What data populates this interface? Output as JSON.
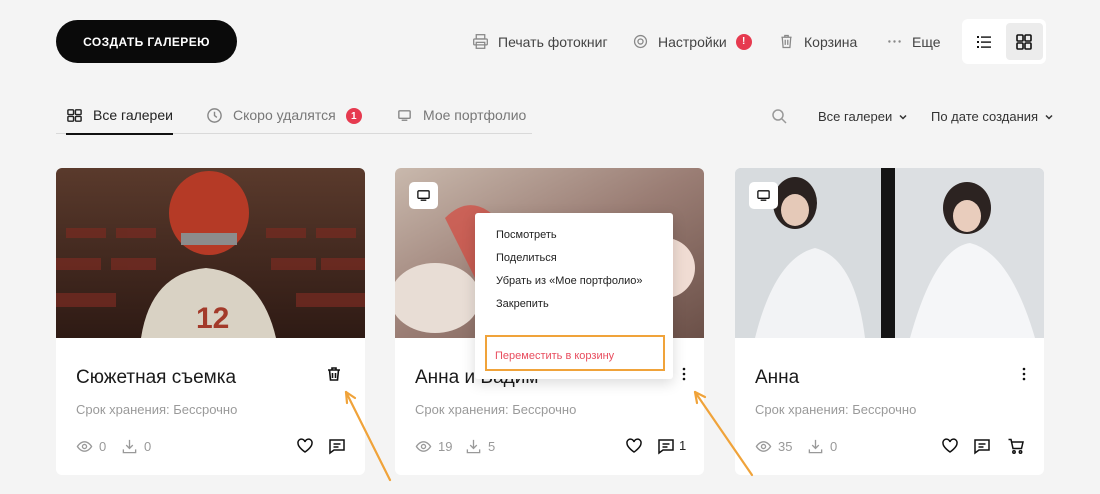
{
  "header": {
    "create_button": "СОЗДАТЬ ГАЛЕРЕЮ",
    "print_label": "Печать фотокниг",
    "settings_label": "Настройки",
    "settings_badge": "!",
    "trash_label": "Корзина",
    "more_label": "Еще"
  },
  "tabs": [
    {
      "label": "Все галереи",
      "icon": "grid-icon",
      "active": true
    },
    {
      "label": "Скоро удалятся",
      "icon": "clock-icon",
      "badge": "1"
    },
    {
      "label": "Мое портфолио",
      "icon": "monitor-icon"
    }
  ],
  "filters": {
    "gallery_filter": "Все галереи",
    "sort": "По дате создания"
  },
  "cards": [
    {
      "title": "Сюжетная съемка",
      "subtitle": "Срок хранения: Бессрочно",
      "views": "0",
      "downloads": "0",
      "comments": ""
    },
    {
      "title": "Анна и Вадим",
      "subtitle": "Срок хранения: Бессрочно",
      "views": "19",
      "downloads": "5",
      "comments": "1"
    },
    {
      "title": "Анна",
      "subtitle": "Срок хранения: Бессрочно",
      "views": "35",
      "downloads": "0",
      "comments": ""
    }
  ],
  "context_menu": {
    "items": [
      "Посмотреть",
      "Поделиться",
      "Убрать из «Мое портфолио»",
      "Закрепить"
    ],
    "danger_item": "Переместить в корзину"
  },
  "colors": {
    "accent": "#e63a4f",
    "highlight": "#f0a33a",
    "primary": "#0a0a0a"
  }
}
